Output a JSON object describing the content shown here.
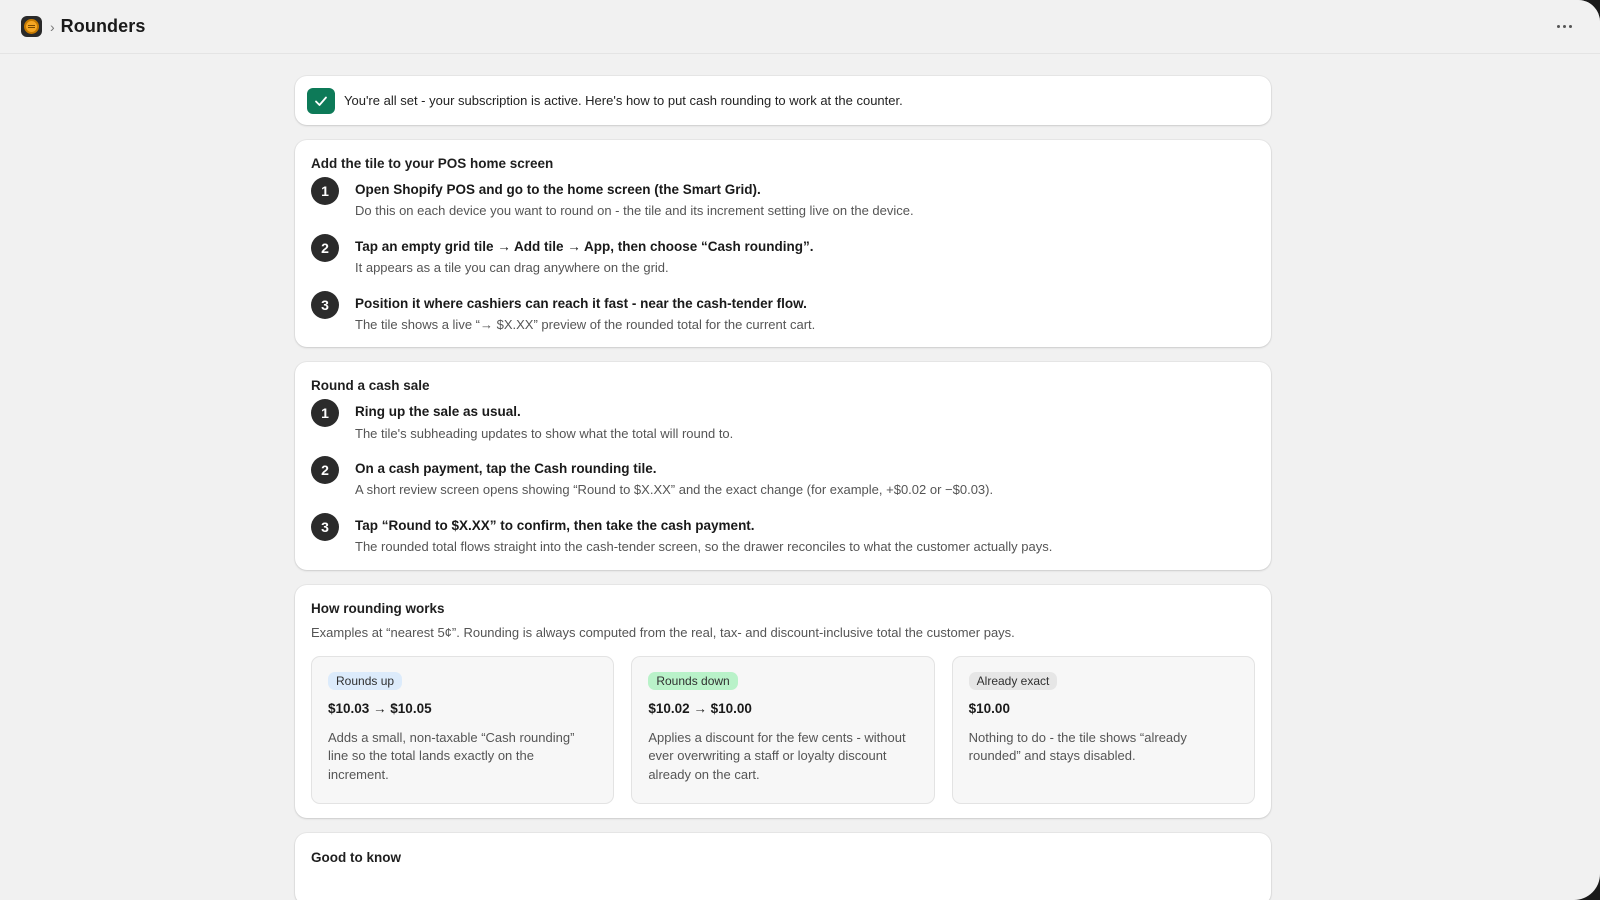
{
  "header": {
    "app_icon": "coin-app-icon",
    "separator": "›",
    "title": "Rounders",
    "more_icon": "more-horizontal-icon"
  },
  "banner": {
    "icon": "checkmark-icon",
    "icon_color": "#0d7a58",
    "text": "You're all set - your subscription is active. Here's how to put cash rounding to work at the counter."
  },
  "setup": {
    "title": "Add the tile to your POS home screen",
    "steps": [
      {
        "num": "1",
        "title": "Open Shopify POS and go to the home screen (the Smart Grid).",
        "desc": "Do this on each device you want to round on - the tile and its increment setting live on the device."
      },
      {
        "num": "2",
        "title": "Tap an empty grid tile → Add tile → App, then choose “Cash rounding”.",
        "desc": "It appears as a tile you can drag anywhere on the grid."
      },
      {
        "num": "3",
        "title": "Position it where cashiers can reach it fast - near the cash-tender flow.",
        "desc": "The tile shows a live “→ $X.XX” preview of the rounded total for the current cart."
      }
    ]
  },
  "sale": {
    "title": "Round a cash sale",
    "steps": [
      {
        "num": "1",
        "title": "Ring up the sale as usual.",
        "desc": "The tile's subheading updates to show what the total will round to."
      },
      {
        "num": "2",
        "title": "On a cash payment, tap the Cash rounding tile.",
        "desc": "A short review screen opens showing “Round to $X.XX” and the exact change (for example, +$0.02 or −$0.03)."
      },
      {
        "num": "3",
        "title": "Tap “Round to $X.XX” to confirm, then take the cash payment.",
        "desc": "The rounded total flows straight into the cash-tender screen, so the drawer reconciles to what the customer actually pays."
      }
    ]
  },
  "how": {
    "title": "How rounding works",
    "desc": "Examples at “nearest 5¢”. Rounding is always computed from the real, tax- and discount-inclusive total the customer pays.",
    "examples": [
      {
        "badge": "Rounds up",
        "badge_color": "#dcebfb",
        "value": "$10.03 → $10.05",
        "desc": "Adds a small, non-taxable “Cash rounding” line so the total lands exactly on the increment."
      },
      {
        "badge": "Rounds down",
        "badge_color": "#b9f2c9",
        "value": "$10.02 → $10.00",
        "desc": "Applies a discount for the few cents - without ever overwriting a staff or loyalty discount already on the cart."
      },
      {
        "badge": "Already exact",
        "badge_color": "#e6e6e6",
        "value": "$10.00",
        "desc": "Nothing to do - the tile shows “already rounded” and stays disabled."
      }
    ]
  },
  "good_to_know": {
    "title": "Good to know"
  }
}
